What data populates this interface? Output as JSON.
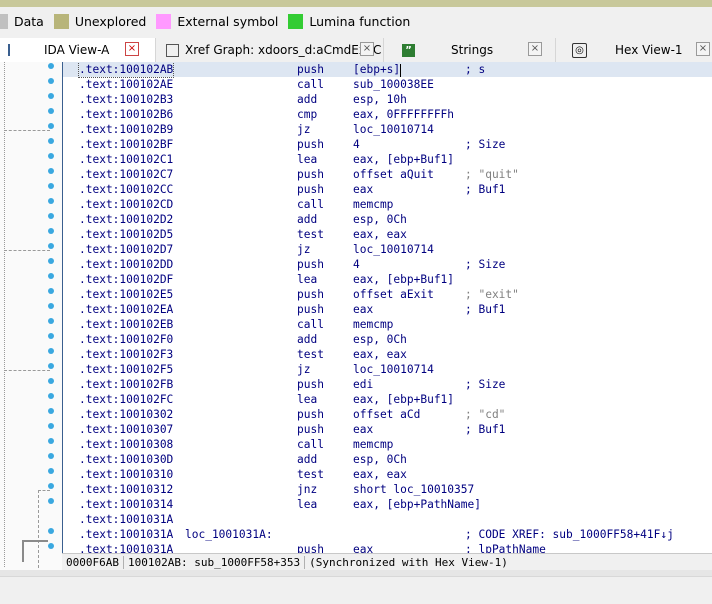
{
  "legend": {
    "items": [
      {
        "label": "Data",
        "color": "#c0c0c0"
      },
      {
        "label": "Unexplored",
        "color": "#b8b57a"
      },
      {
        "label": "External symbol",
        "color": "#ff99ff"
      },
      {
        "label": "Lumina function",
        "color": "#33cc33"
      }
    ]
  },
  "tabs": [
    {
      "label": "IDA View-A",
      "icon": "list-icon",
      "active": true
    },
    {
      "label": "Xref Graph: xdoors_d:aCmdExeC",
      "icon": "graph-icon",
      "active": false
    },
    {
      "label": "Strings",
      "icon": "quote-icon",
      "active": false
    },
    {
      "label": "Hex View-1",
      "icon": "hex-icon",
      "active": false
    }
  ],
  "tab_close_glyph": "×",
  "rows": [
    {
      "addr": ".text:100102AB",
      "loc": "",
      "mn": "push",
      "op": "[ebp+s]",
      "cmt": "; s",
      "selected": true
    },
    {
      "addr": ".text:100102AE",
      "loc": "",
      "mn": "call",
      "op": "sub_100038EE",
      "cmt": ""
    },
    {
      "addr": ".text:100102B3",
      "loc": "",
      "mn": "add",
      "op": "esp, 10h",
      "cmt": ""
    },
    {
      "addr": ".text:100102B6",
      "loc": "",
      "mn": "cmp",
      "op": "eax, 0FFFFFFFFh",
      "cmt": ""
    },
    {
      "addr": ".text:100102B9",
      "loc": "",
      "mn": "jz",
      "op": "loc_10010714",
      "cmt": ""
    },
    {
      "addr": ".text:100102BF",
      "loc": "",
      "mn": "push",
      "op": "4",
      "cmt": "; Size"
    },
    {
      "addr": ".text:100102C1",
      "loc": "",
      "mn": "lea",
      "op": "eax, [ebp+Buf1]",
      "cmt": ""
    },
    {
      "addr": ".text:100102C7",
      "loc": "",
      "mn": "push",
      "op": "offset aQuit",
      "cmt": "; \"quit\"",
      "cmt_gray": true
    },
    {
      "addr": ".text:100102CC",
      "loc": "",
      "mn": "push",
      "op": "eax",
      "cmt": "; Buf1"
    },
    {
      "addr": ".text:100102CD",
      "loc": "",
      "mn": "call",
      "op": "memcmp",
      "cmt": ""
    },
    {
      "addr": ".text:100102D2",
      "loc": "",
      "mn": "add",
      "op": "esp, 0Ch",
      "cmt": ""
    },
    {
      "addr": ".text:100102D5",
      "loc": "",
      "mn": "test",
      "op": "eax, eax",
      "cmt": ""
    },
    {
      "addr": ".text:100102D7",
      "loc": "",
      "mn": "jz",
      "op": "loc_10010714",
      "cmt": ""
    },
    {
      "addr": ".text:100102DD",
      "loc": "",
      "mn": "push",
      "op": "4",
      "cmt": "; Size"
    },
    {
      "addr": ".text:100102DF",
      "loc": "",
      "mn": "lea",
      "op": "eax, [ebp+Buf1]",
      "cmt": ""
    },
    {
      "addr": ".text:100102E5",
      "loc": "",
      "mn": "push",
      "op": "offset aExit",
      "cmt": "; \"exit\"",
      "cmt_gray": true
    },
    {
      "addr": ".text:100102EA",
      "loc": "",
      "mn": "push",
      "op": "eax",
      "cmt": "; Buf1"
    },
    {
      "addr": ".text:100102EB",
      "loc": "",
      "mn": "call",
      "op": "memcmp",
      "cmt": ""
    },
    {
      "addr": ".text:100102F0",
      "loc": "",
      "mn": "add",
      "op": "esp, 0Ch",
      "cmt": ""
    },
    {
      "addr": ".text:100102F3",
      "loc": "",
      "mn": "test",
      "op": "eax, eax",
      "cmt": ""
    },
    {
      "addr": ".text:100102F5",
      "loc": "",
      "mn": "jz",
      "op": "loc_10010714",
      "cmt": ""
    },
    {
      "addr": ".text:100102FB",
      "loc": "",
      "mn": "push",
      "op": "edi",
      "cmt": "; Size"
    },
    {
      "addr": ".text:100102FC",
      "loc": "",
      "mn": "lea",
      "op": "eax, [ebp+Buf1]",
      "cmt": ""
    },
    {
      "addr": ".text:10010302",
      "loc": "",
      "mn": "push",
      "op": "offset aCd",
      "cmt": "; \"cd\"",
      "cmt_gray": true
    },
    {
      "addr": ".text:10010307",
      "loc": "",
      "mn": "push",
      "op": "eax",
      "cmt": "; Buf1"
    },
    {
      "addr": ".text:10010308",
      "loc": "",
      "mn": "call",
      "op": "memcmp",
      "cmt": ""
    },
    {
      "addr": ".text:1001030D",
      "loc": "",
      "mn": "add",
      "op": "esp, 0Ch",
      "cmt": ""
    },
    {
      "addr": ".text:10010310",
      "loc": "",
      "mn": "test",
      "op": "eax, eax",
      "cmt": ""
    },
    {
      "addr": ".text:10010312",
      "loc": "",
      "mn": "jnz",
      "op": "short loc_10010357",
      "cmt": ""
    },
    {
      "addr": ".text:10010314",
      "loc": "",
      "mn": "lea",
      "op": "eax, [ebp+PathName]",
      "cmt": ""
    },
    {
      "addr": ".text:1001031A",
      "loc": "",
      "mn": "",
      "op": "",
      "cmt": ""
    },
    {
      "addr": ".text:1001031A",
      "loc": "loc_1001031A:",
      "mn": "",
      "op": "",
      "cmt": "; CODE XREF: sub_1000FF58+41F↓j"
    },
    {
      "addr": ".text:1001031A",
      "loc": "",
      "mn": "push",
      "op": "eax",
      "cmt": "; lpPathName"
    }
  ],
  "status": {
    "offset": "0000F6AB",
    "location": "100102AB: sub_1000FF58+353",
    "sync": "(Synchronized with Hex View-1)"
  }
}
